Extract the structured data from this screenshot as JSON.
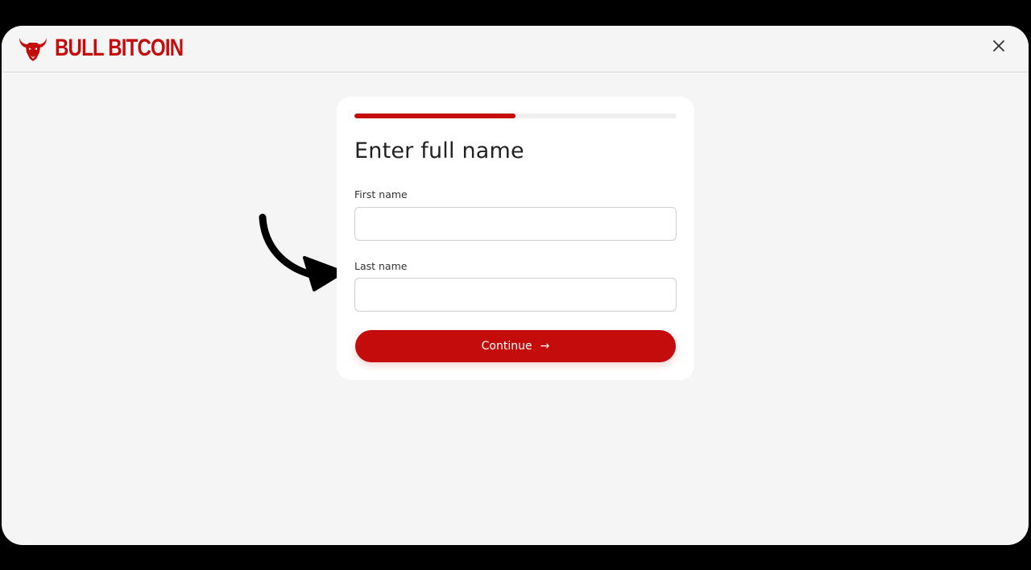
{
  "header": {
    "brand": "BULL BITCOIN",
    "logo_icon": "bull-head-icon",
    "close_icon": "close-icon"
  },
  "form": {
    "progress_fraction": 0.5,
    "title": "Enter full name",
    "first_name": {
      "label": "First name",
      "value": ""
    },
    "last_name": {
      "label": "Last name",
      "value": ""
    },
    "continue_label": "Continue",
    "continue_icon": "arrow-right-icon"
  },
  "annotation": {
    "icon": "curved-arrow-icon"
  },
  "colors": {
    "brand_red": "#c40c0c",
    "background": "#f5f5f5",
    "card": "#ffffff"
  }
}
